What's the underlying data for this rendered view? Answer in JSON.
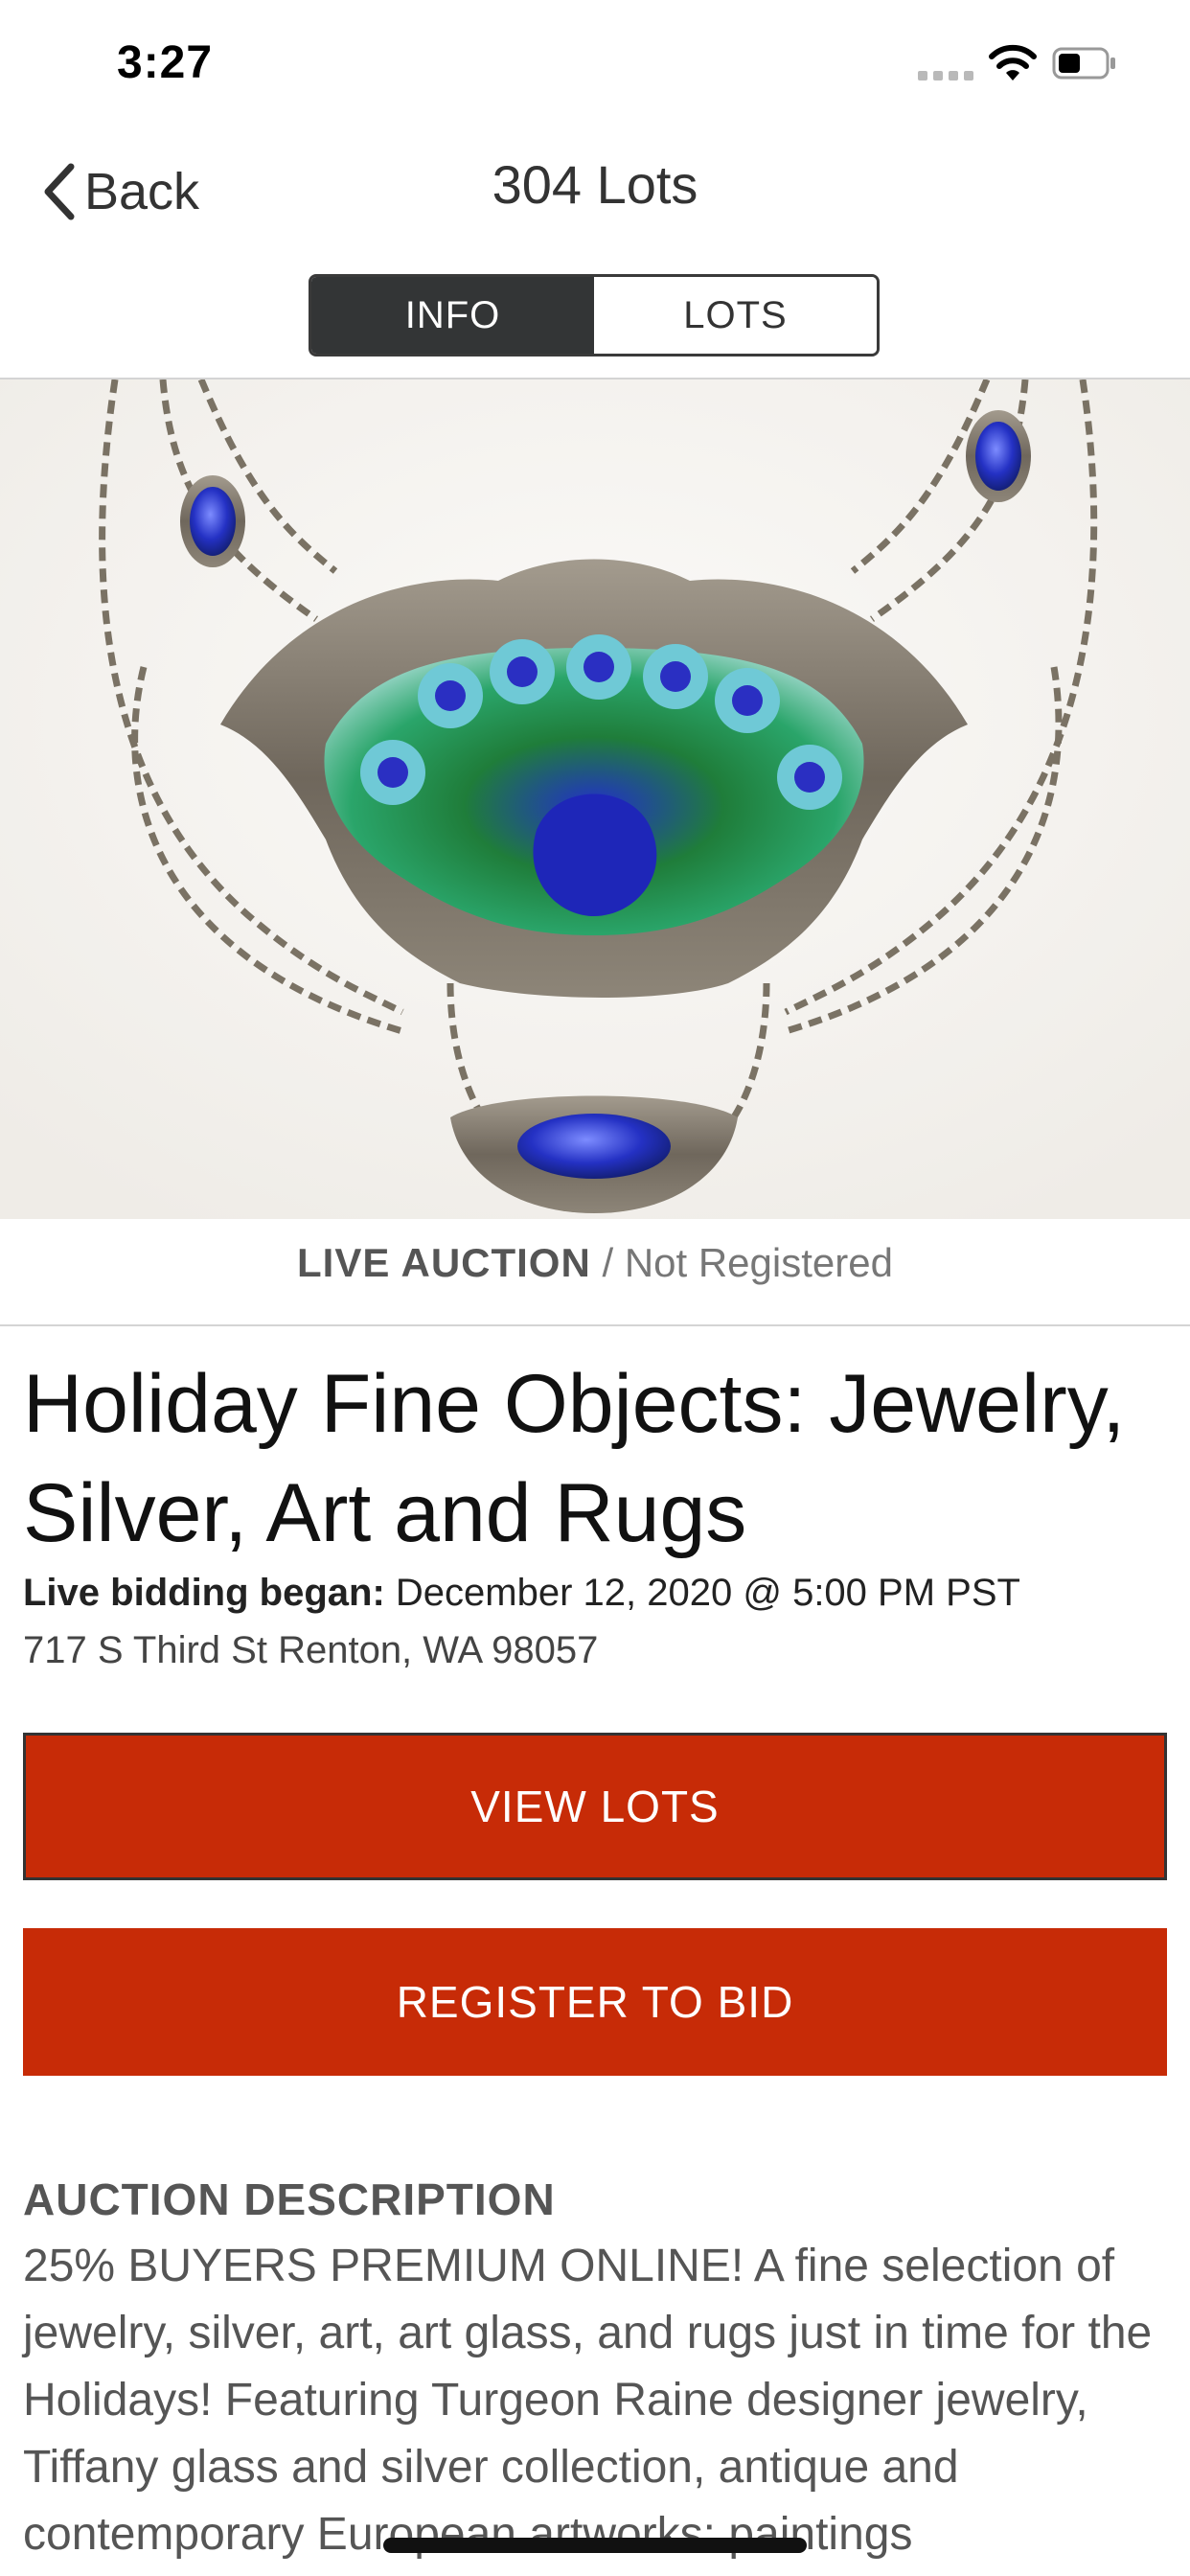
{
  "status_bar": {
    "time": "3:27"
  },
  "nav": {
    "back_label": "Back",
    "title": "304 Lots"
  },
  "tabs": [
    {
      "label": "INFO",
      "active": true
    },
    {
      "label": "LOTS",
      "active": false
    }
  ],
  "hero": {
    "icon": "enamel-peacock-necklace-photo"
  },
  "auction": {
    "status_type": "LIVE AUCTION",
    "status_separator": " / ",
    "registration": "Not Registered",
    "title": "Holiday Fine Objects: Jewelry, Silver, Art and Rugs",
    "bidding_label": "Live bidding began:",
    "bidding_value": "December 12, 2020 @ 5:00 PM PST",
    "address": "717 S Third St Renton, WA 98057"
  },
  "buttons": {
    "view_lots": "VIEW LOTS",
    "register": "REGISTER TO BID"
  },
  "description": {
    "heading": "AUCTION DESCRIPTION",
    "body": "25% BUYERS PREMIUM ONLINE! A fine selection of jewelry, silver, art, art glass, and rugs just in time for the Holidays! Featuring Turgeon Raine designer jewelry, Tiffany glass and silver collection, antique and contemporary European artworks: paintings"
  },
  "colors": {
    "accent": "#c72b07",
    "segment_active": "#333536",
    "muted_text": "#555555"
  }
}
